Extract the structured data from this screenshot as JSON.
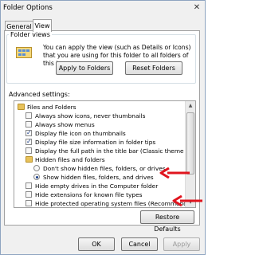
{
  "window": {
    "title": "Folder Options",
    "close_glyph": "✕"
  },
  "tabs": [
    {
      "label": "General",
      "selected": false
    },
    {
      "label": "View",
      "selected": true
    }
  ],
  "folder_views": {
    "heading": "Folder views",
    "description": "You can apply the view (such as Details or Icons) that you are using for this folder to all folders of this type.",
    "apply_button": "Apply to Folders",
    "reset_button": "Reset Folders"
  },
  "advanced": {
    "heading": "Advanced settings:",
    "items": [
      {
        "type": "folder",
        "label": "Files and Folders",
        "level": 0
      },
      {
        "type": "checkbox",
        "label": "Always show icons, never thumbnails",
        "checked": false,
        "level": 1
      },
      {
        "type": "checkbox",
        "label": "Always show menus",
        "checked": false,
        "level": 1
      },
      {
        "type": "checkbox",
        "label": "Display file icon on thumbnails",
        "checked": true,
        "level": 1
      },
      {
        "type": "checkbox",
        "label": "Display file size information in folder tips",
        "checked": true,
        "level": 1
      },
      {
        "type": "checkbox",
        "label": "Display the full path in the title bar (Classic theme only)",
        "checked": false,
        "level": 1
      },
      {
        "type": "folder",
        "label": "Hidden files and folders",
        "level": 1
      },
      {
        "type": "radio",
        "label": "Don't show hidden files, folders, or drives",
        "checked": false,
        "level": 2
      },
      {
        "type": "radio",
        "label": "Show hidden files, folders, and drives",
        "checked": true,
        "level": 2
      },
      {
        "type": "checkbox",
        "label": "Hide empty drives in the Computer folder",
        "checked": false,
        "level": 1
      },
      {
        "type": "checkbox",
        "label": "Hide extensions for known file types",
        "checked": false,
        "level": 1
      },
      {
        "type": "checkbox",
        "label": "Hide protected operating system files (Recommended)",
        "checked": false,
        "level": 1
      }
    ],
    "restore_button": "Restore Defaults"
  },
  "footer": {
    "ok": "OK",
    "cancel": "Cancel",
    "apply": "Apply"
  },
  "colors": {
    "annotation_arrow": "#e0141e",
    "check_mark": "#1c3f8a"
  }
}
